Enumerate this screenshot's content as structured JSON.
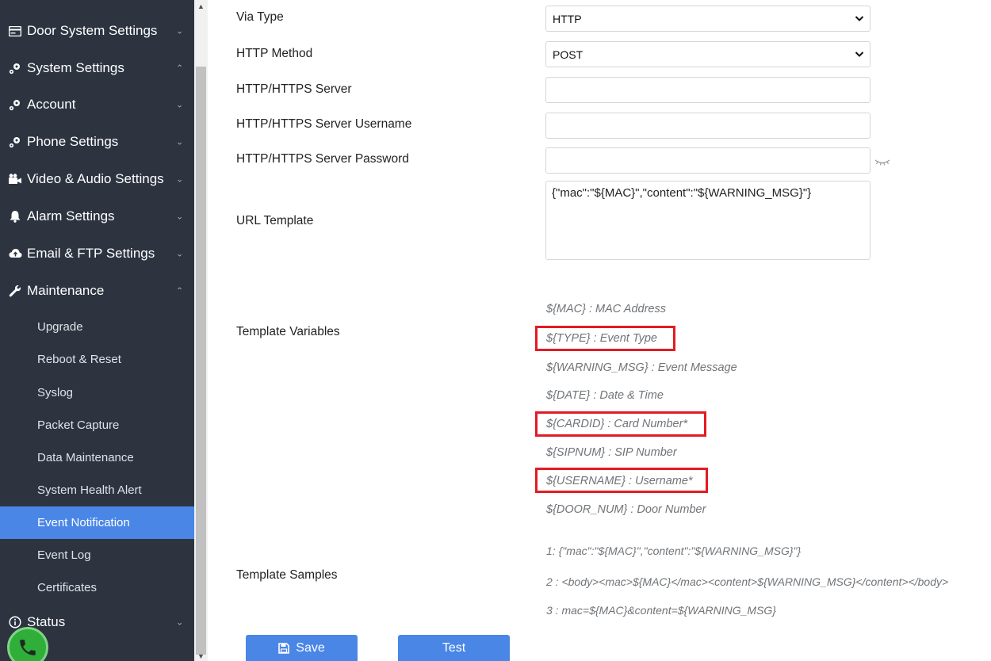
{
  "sidebar": {
    "sections": [
      {
        "label": "Door System Settings",
        "icon": "card-icon",
        "chevron": "⌄"
      },
      {
        "label": "System Settings",
        "icon": "gears-icon",
        "chevron": "⌃"
      },
      {
        "label": "Account",
        "icon": "gears-icon",
        "chevron": "⌄"
      },
      {
        "label": "Phone Settings",
        "icon": "gears-icon",
        "chevron": "⌄"
      },
      {
        "label": "Video & Audio Settings",
        "icon": "camera-icon",
        "chevron": "⌄"
      },
      {
        "label": "Alarm Settings",
        "icon": "bell-icon",
        "chevron": "⌄"
      },
      {
        "label": "Email & FTP Settings",
        "icon": "cloud-icon",
        "chevron": "⌄"
      },
      {
        "label": "Maintenance",
        "icon": "wrench-icon",
        "chevron": "⌃"
      }
    ],
    "maintenance_items": [
      {
        "label": "Upgrade"
      },
      {
        "label": "Reboot & Reset"
      },
      {
        "label": "Syslog"
      },
      {
        "label": "Packet Capture"
      },
      {
        "label": "Data Maintenance"
      },
      {
        "label": "System Health Alert"
      },
      {
        "label": "Event Notification",
        "active": true
      },
      {
        "label": "Event Log"
      },
      {
        "label": "Certificates"
      }
    ],
    "status": {
      "label": "Status",
      "icon": "info-icon",
      "chevron": "⌄"
    }
  },
  "form": {
    "via_type": {
      "label": "Via Type",
      "value": "HTTP"
    },
    "http_method": {
      "label": "HTTP Method",
      "value": "POST"
    },
    "server": {
      "label": "HTTP/HTTPS Server",
      "value": ""
    },
    "username": {
      "label": "HTTP/HTTPS Server Username",
      "value": ""
    },
    "password": {
      "label": "HTTP/HTTPS Server Password",
      "value": ""
    },
    "url_template": {
      "label": "URL Template",
      "value": "{\"mac\":\"${MAC}\",\"content\":\"${WARNING_MSG}\"}"
    },
    "template_variables": {
      "label": "Template Variables",
      "items": [
        "${MAC} : MAC Address",
        "${TYPE} : Event Type",
        "${WARNING_MSG} : Event Message",
        "${DATE} : Date & Time",
        "${CARDID} : Card Number*",
        "${SIPNUM} : SIP Number",
        "${USERNAME} : Username*",
        "${DOOR_NUM} : Door Number"
      ]
    },
    "template_samples": {
      "label": "Template Samples",
      "items": [
        "1: {\"mac\":\"${MAC}\",\"content\":\"${WARNING_MSG}\"}",
        "2 : <body><mac>${MAC}</mac><content>${WARNING_MSG}</content></body>",
        "3 : mac=${MAC}&content=${WARNING_MSG}"
      ]
    }
  },
  "buttons": {
    "save": "Save",
    "test": "Test"
  },
  "colors": {
    "sidebar_bg": "#2d3440",
    "accent": "#4a86e6",
    "highlight": "#e31b23"
  }
}
